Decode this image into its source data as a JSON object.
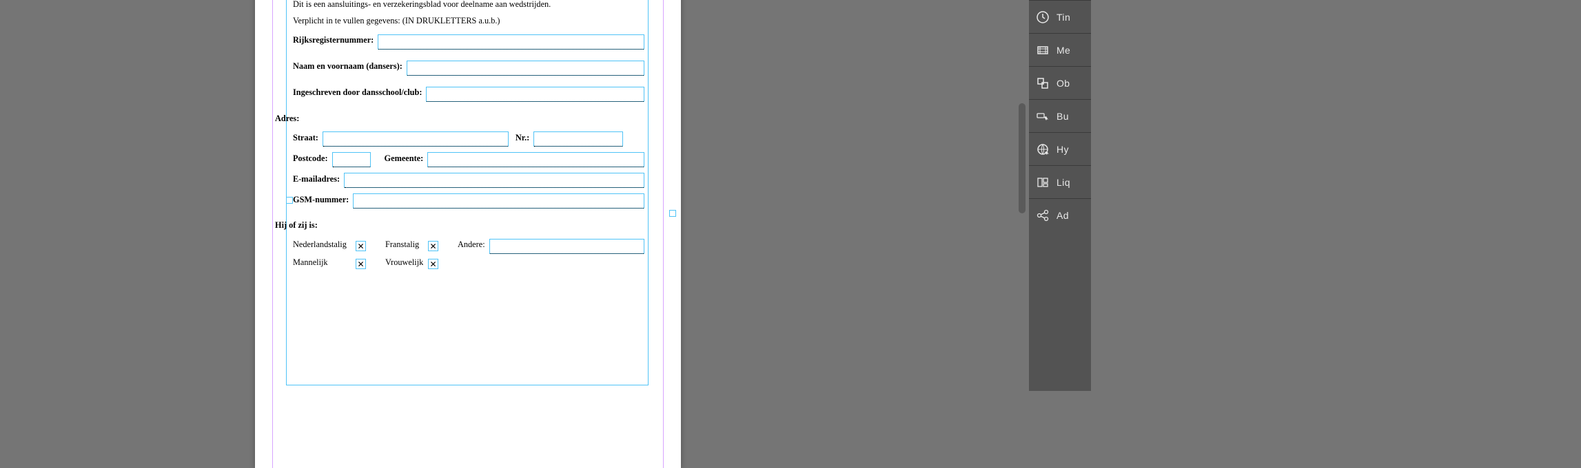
{
  "doc": {
    "intro": "Dit is een aansluitings- en verzekeringsblad voor deelname aan wedstrijden.",
    "mandatory": "Verplicht in te vullen gegevens: (IN DRUKLETTERS a.u.b.)",
    "labels": {
      "rijksregister": "Rijksregisternummer:",
      "naam": "Naam en voornaam (dansers):",
      "ingeschreven": "Ingeschreven door dansschool/club:",
      "adres": "Adres:",
      "straat": "Straat:",
      "nr": "Nr.:",
      "postcode": "Postcode:",
      "gemeente": "Gemeente:",
      "email": "E-mailadres:",
      "gsm": "GSM-nummer:",
      "hijzij": "Hij of zij is:",
      "nederlandstalig": "Nederlandstalig",
      "franstalig": "Franstalig",
      "andere": "Andere:",
      "mannelijk": "Mannelijk",
      "vrouwelijk": "Vrouwelijk"
    }
  },
  "panels": {
    "tin": "Tin",
    "me": "Me",
    "ob": "Ob",
    "but": "Bu",
    "hy": "Hy",
    "liq": "Liq",
    "ad": "Ad"
  }
}
